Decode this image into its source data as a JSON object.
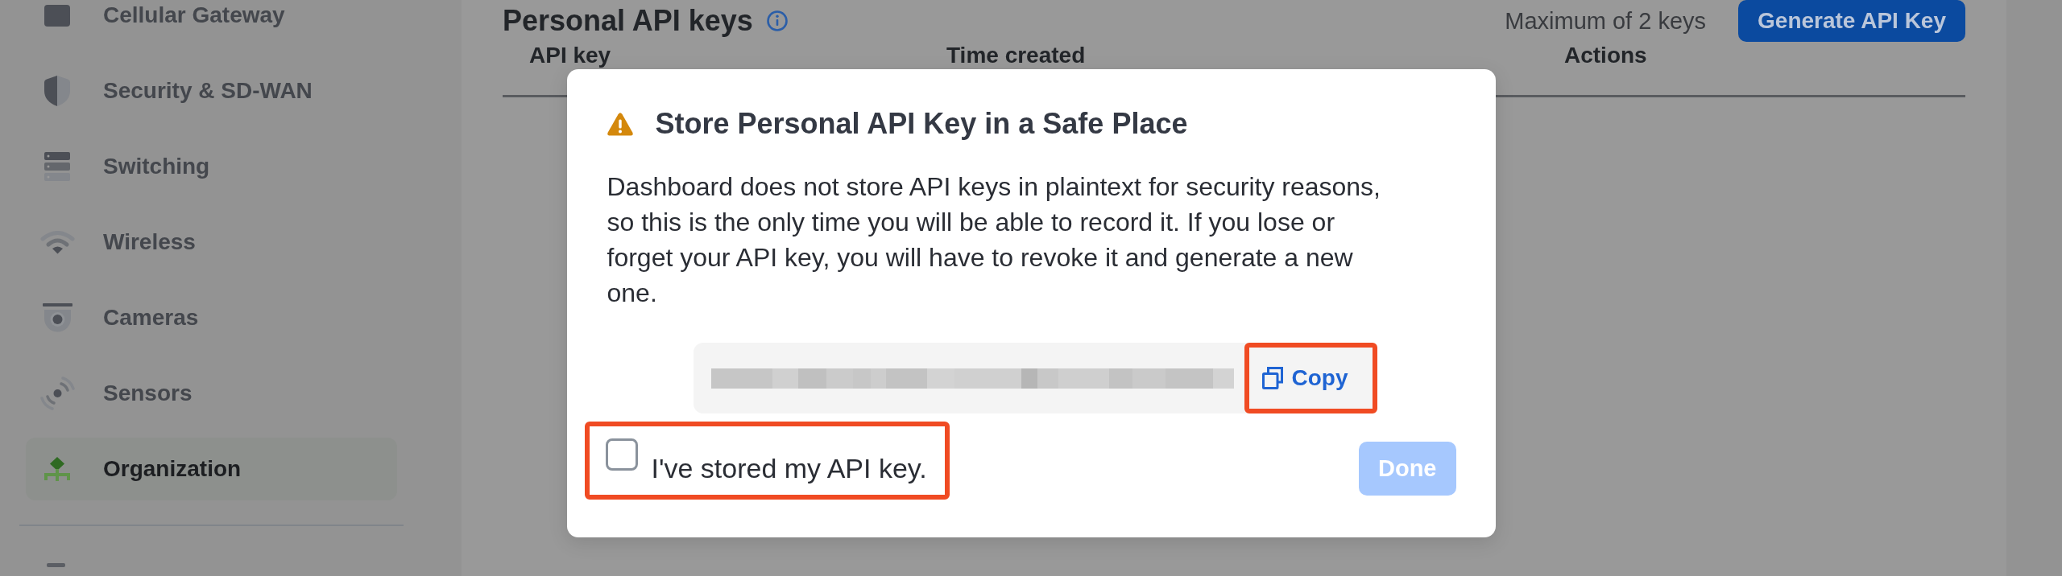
{
  "sidebar": {
    "items": [
      {
        "label": "Cellular Gateway",
        "selected": false
      },
      {
        "label": "Security & SD-WAN",
        "selected": false
      },
      {
        "label": "Switching",
        "selected": false
      },
      {
        "label": "Wireless",
        "selected": false
      },
      {
        "label": "Cameras",
        "selected": false
      },
      {
        "label": "Sensors",
        "selected": false
      },
      {
        "label": "Organization",
        "selected": true
      }
    ]
  },
  "header": {
    "title": "Personal API keys",
    "limit": "Maximum of 2 keys",
    "button": "Generate API Key"
  },
  "table": {
    "columns": [
      "API key",
      "Time created",
      "Actions"
    ]
  },
  "dialog": {
    "title": "Store Personal API Key in a Safe Place",
    "message": "Dashboard does not store API keys in plaintext for security reasons, so this is the only time you will be able to record it. If you lose or forget your API key, you will have to revoke it and generate a new one.",
    "copy_button": {
      "label": "Copy",
      "highlighted": true
    },
    "confirm": {
      "label": "I've stored my API key.",
      "checked": false,
      "highlighted": true
    },
    "done_button": {
      "label": "Done",
      "disabled": true
    }
  }
}
